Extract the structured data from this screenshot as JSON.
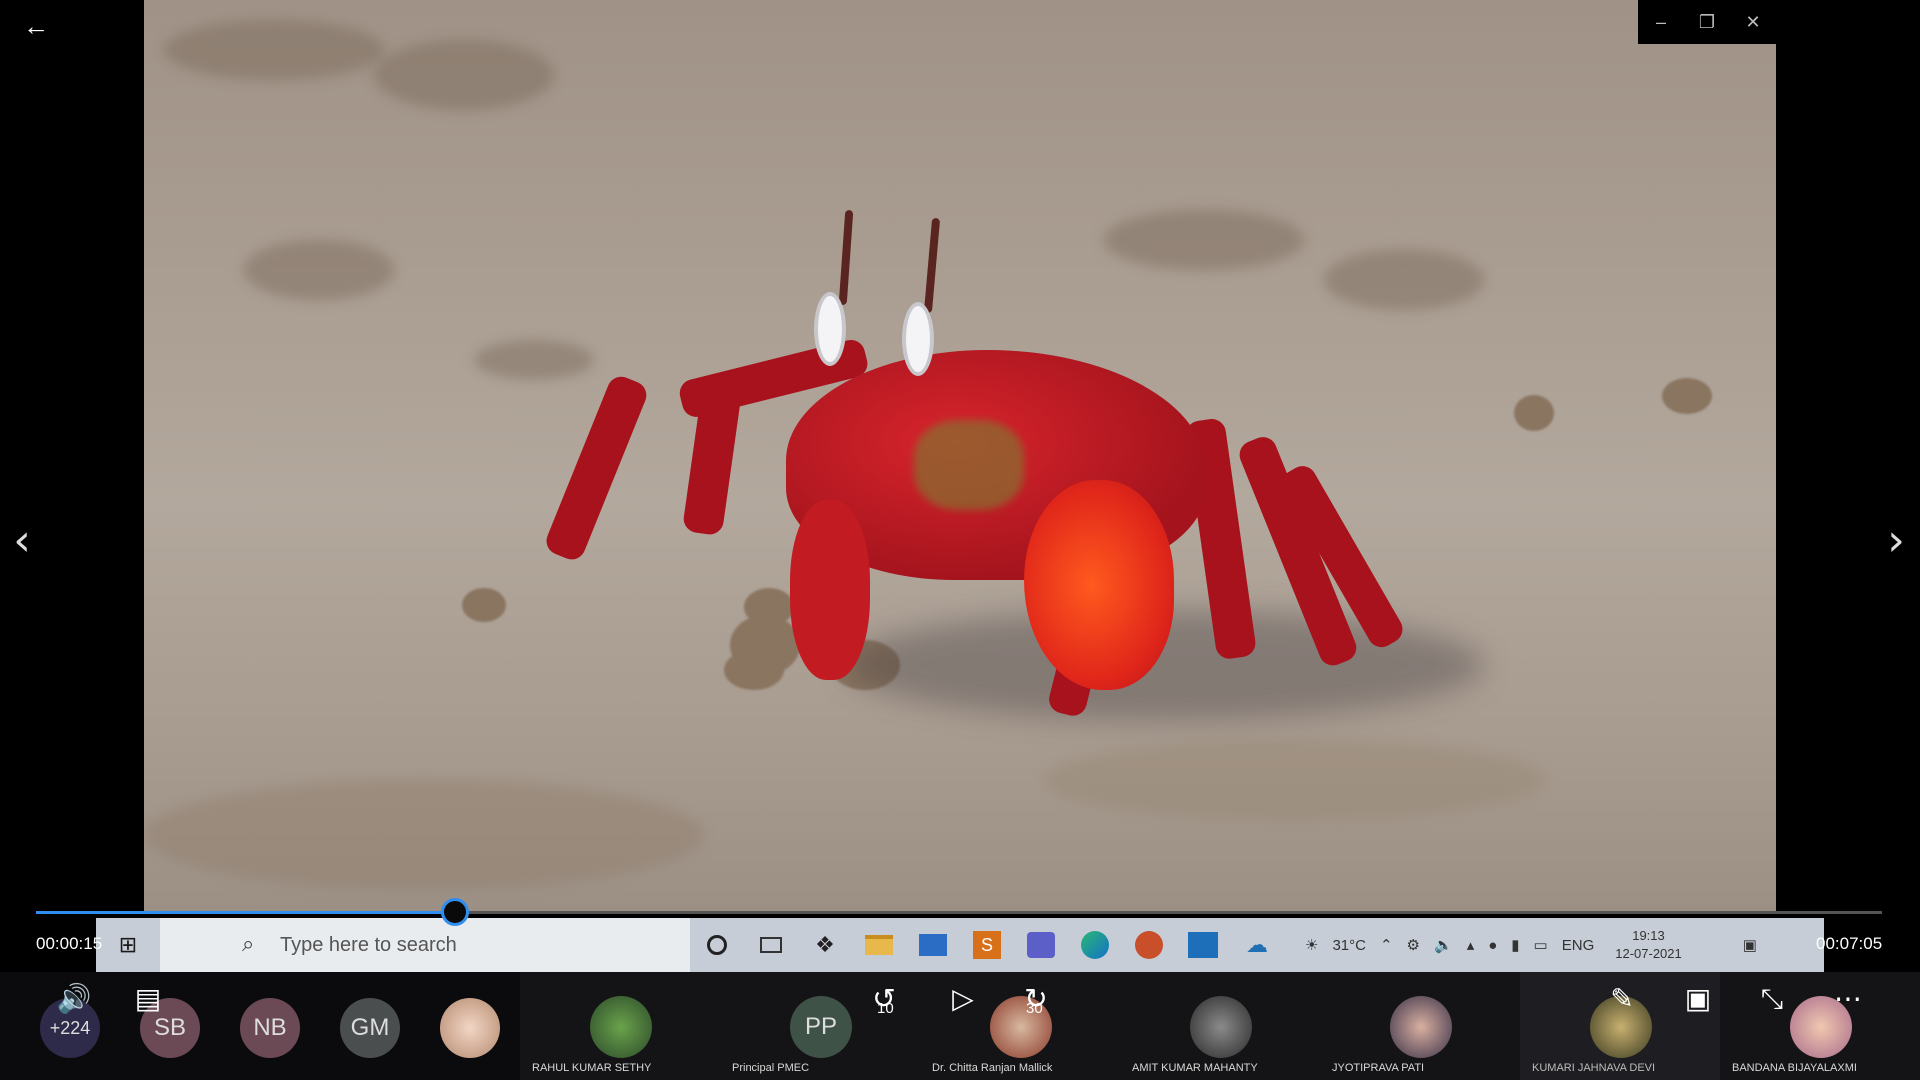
{
  "navigation": {
    "back_label": "←",
    "prev_label": "‹",
    "next_label": "›"
  },
  "window_controls": {
    "minimize": "–",
    "restore": "❐",
    "close": "✕"
  },
  "playback": {
    "elapsed": "00:00:15",
    "total": "00:07:05",
    "progress_fraction": 0.227,
    "skip_back_seconds": "10",
    "skip_forward_seconds": "30"
  },
  "taskbar": {
    "search_placeholder": "Type here to search",
    "weather": "31°C",
    "language": "ENG",
    "time": "19:13",
    "date": "12-07-2021",
    "icons": [
      "cortana-icon",
      "task-view-icon",
      "dropbox-icon",
      "file-explorer-icon",
      "mail-icon",
      "slides-app-icon",
      "teams-icon",
      "edge-icon",
      "powerpoint-icon",
      "media-player-icon",
      "remote-icon"
    ]
  },
  "participants": {
    "overflow_count": "+224",
    "initials": [
      "SB",
      "NB",
      "GM"
    ],
    "tiles": [
      {
        "name": "RAHUL KUMAR SETHY"
      },
      {
        "name": "Principal PMEC",
        "initials": "PP"
      },
      {
        "name": "Dr. Chitta Ranjan Mallick"
      },
      {
        "name": "AMIT KUMAR MAHANTY"
      },
      {
        "name": "JYOTIPRAVA PATI"
      },
      {
        "name": "KUMARI JAHNAVA DEVI"
      },
      {
        "name": "BANDANA BIJAYALAXMI"
      }
    ]
  },
  "colors": {
    "accent": "#2f8ef0",
    "taskbar": "#c6cdd6",
    "crab": "#c21b22"
  }
}
